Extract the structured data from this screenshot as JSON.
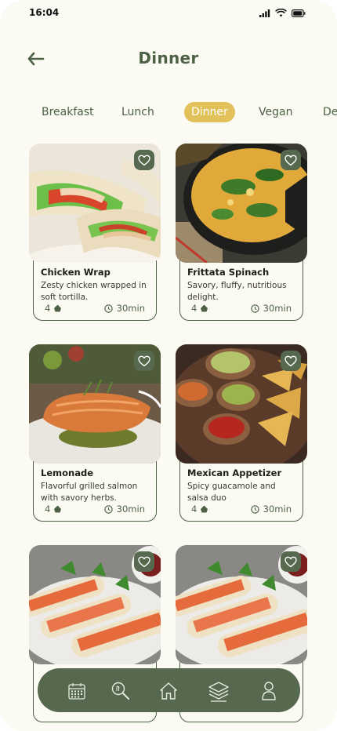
{
  "status": {
    "time": "16:04"
  },
  "header": {
    "title": "Dinner"
  },
  "tabs": [
    {
      "label": "Breakfast"
    },
    {
      "label": "Lunch"
    },
    {
      "label": "Dinner"
    },
    {
      "label": "Vegan"
    },
    {
      "label": "De"
    }
  ],
  "recipes": [
    {
      "name": "Chicken Wrap",
      "description": "Zesty chicken wrapped in soft tortilla.",
      "count": "4",
      "duration": "30min"
    },
    {
      "name": "Frittata Spinach",
      "description": "Savory, fluffy, nutritious delight.",
      "count": "4",
      "duration": "30min"
    },
    {
      "name": "Lemonade",
      "description": "Flavorful grilled salmon with savory herbs.",
      "count": "4",
      "duration": "30min"
    },
    {
      "name": "Mexican Appetizer",
      "description": "Spicy guacamole and salsa duo",
      "count": "4",
      "duration": "30min"
    },
    {
      "name": "",
      "description": "",
      "count": "",
      "duration": ""
    },
    {
      "name": "",
      "description": "",
      "count": "",
      "duration": ""
    }
  ],
  "nav": {
    "items": [
      "calendar-icon",
      "search-recipe-icon",
      "home-icon",
      "layers-icon",
      "profile-icon"
    ]
  },
  "colors": {
    "primary": "#56694f",
    "accent": "#e2c15a",
    "background": "#fbfaf3"
  }
}
